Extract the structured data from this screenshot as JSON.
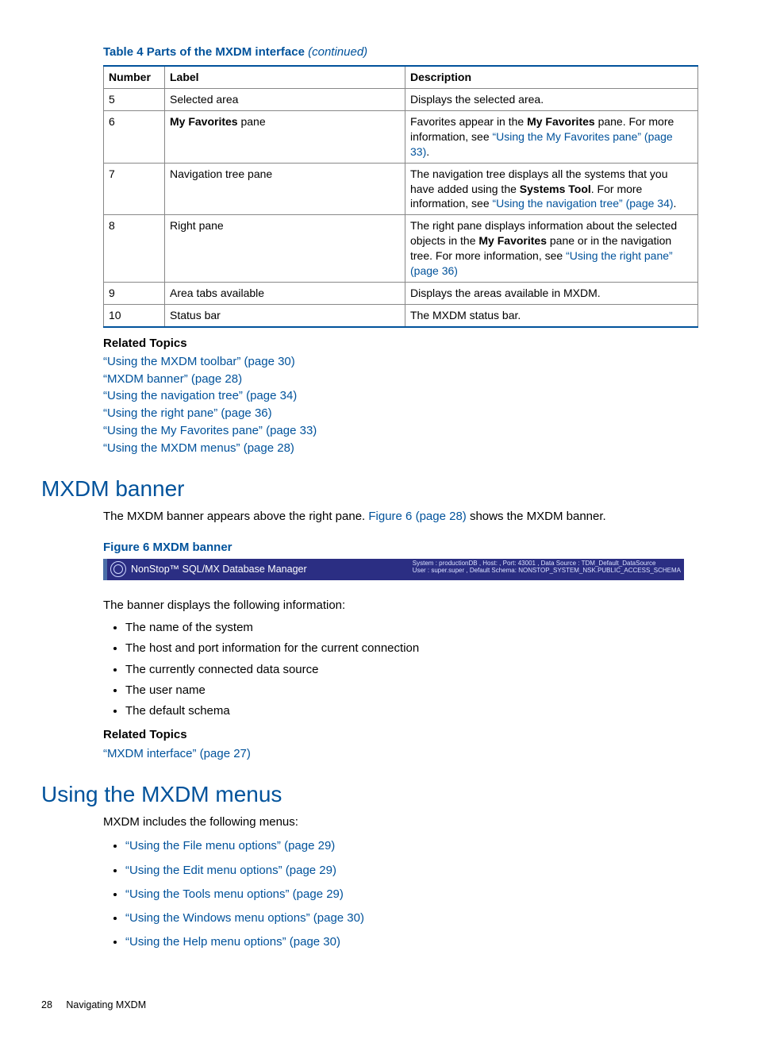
{
  "tableCaption": "Table 4 Parts of the MXDM interface",
  "tableCaptionCont": "(continued)",
  "headers": {
    "c1": "Number",
    "c2": "Label",
    "c3": "Description"
  },
  "rows": [
    {
      "num": "5",
      "label_pre": "",
      "label_bold": "",
      "label_post": "Selected area",
      "desc_pre": "Displays the selected area.",
      "desc_bold": "",
      "desc_mid": "",
      "desc_link": "",
      "desc_post": ""
    },
    {
      "num": "6",
      "label_pre": "",
      "label_bold": "My Favorites",
      "label_post": " pane",
      "desc_pre": "Favorites appear in the ",
      "desc_bold": "My Favorites",
      "desc_mid": " pane. For more information, see ",
      "desc_link": "“Using the My Favorites pane” (page 33)",
      "desc_post": "."
    },
    {
      "num": "7",
      "label_pre": "",
      "label_bold": "",
      "label_post": "Navigation tree pane",
      "desc_pre": "The navigation tree displays all the systems that you have added using the ",
      "desc_bold": "Systems Tool",
      "desc_mid": ". For more information, see ",
      "desc_link": "“Using the navigation tree” (page 34)",
      "desc_post": "."
    },
    {
      "num": "8",
      "label_pre": "",
      "label_bold": "",
      "label_post": "Right pane",
      "desc_pre": "The right pane displays information about the selected objects in the ",
      "desc_bold": "My Favorites",
      "desc_mid": " pane or in the navigation tree. For more information, see ",
      "desc_link": "“Using the right pane” (page 36)",
      "desc_post": ""
    },
    {
      "num": "9",
      "label_pre": "",
      "label_bold": "",
      "label_post": "Area tabs available",
      "desc_pre": "Displays the areas available in MXDM.",
      "desc_bold": "",
      "desc_mid": "",
      "desc_link": "",
      "desc_post": ""
    },
    {
      "num": "10",
      "label_pre": "",
      "label_bold": "",
      "label_post": "Status bar",
      "desc_pre": "The MXDM status bar.",
      "desc_bold": "",
      "desc_mid": "",
      "desc_link": "",
      "desc_post": ""
    }
  ],
  "relatedTopicsLabel": "Related Topics",
  "relatedTopics1": [
    "“Using the MXDM toolbar” (page 30)",
    "“MXDM banner” (page 28)",
    "“Using the navigation tree” (page 34)",
    "“Using the right pane” (page 36)",
    "“Using the My Favorites pane” (page 33)",
    "“Using the MXDM menus” (page 28)"
  ],
  "section1": {
    "title": "MXDM banner",
    "intro_a": "The MXDM banner appears above the right pane. ",
    "intro_link": "Figure 6 (page 28)",
    "intro_b": " shows the MXDM banner.",
    "figCaption": "Figure 6 MXDM banner",
    "bannerTitle": "NonStop™ SQL/MX Database Manager",
    "bannerMeta1": "System : productionDB , Host:                         , Port: 43001 , Data Source : TDM_Default_DataSource",
    "bannerMeta2": "User : super.super , Default Schema: NONSTOP_SYSTEM_NSK.PUBLIC_ACCESS_SCHEMA",
    "after": "The banner displays the following information:",
    "bullets": [
      "The name of the system",
      "The host and port information for the current connection",
      "The currently connected data source",
      "The user name",
      "The default schema"
    ],
    "related": [
      "“MXDM interface” (page 27)"
    ]
  },
  "section2": {
    "title": "Using the MXDM menus",
    "intro": "MXDM includes the following menus:",
    "bullets": [
      "“Using the File menu options” (page 29)",
      "“Using the Edit menu options” (page 29)",
      "“Using the Tools menu options” (page 29)",
      "“Using the Windows menu options” (page 30)",
      "“Using the Help menu options” (page 30)"
    ]
  },
  "footer": {
    "page": "28",
    "chapter": "Navigating MXDM"
  }
}
